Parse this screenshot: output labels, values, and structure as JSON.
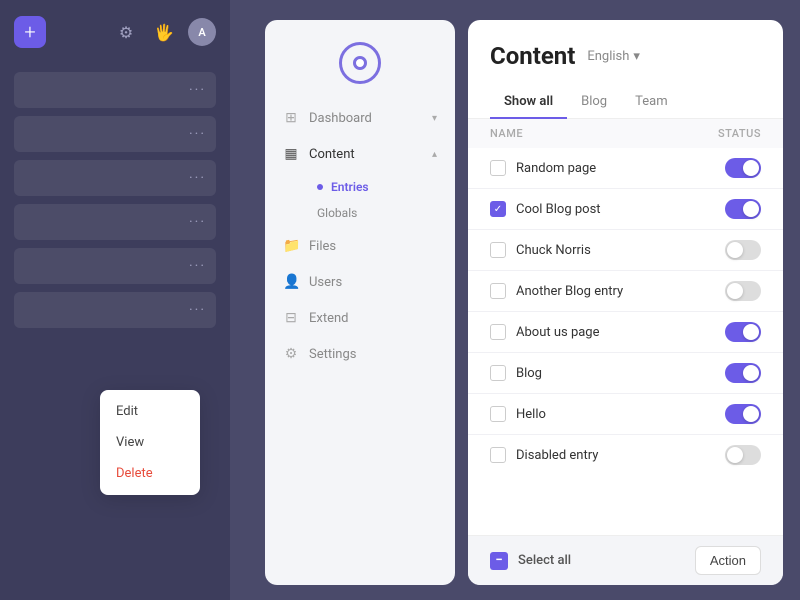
{
  "leftPanel": {
    "addBtn": "+",
    "avatarLabel": "A",
    "cards": [
      {
        "dots": "···"
      },
      {
        "dots": "···"
      },
      {
        "dots": "···"
      },
      {
        "dots": "···"
      },
      {
        "dots": "···"
      },
      {
        "dots": "···"
      }
    ],
    "contextMenu": {
      "edit": "Edit",
      "view": "View",
      "delete": "Delete"
    }
  },
  "sidebar": {
    "navItems": [
      {
        "label": "Dashboard",
        "icon": "⊞",
        "hasChevron": true
      },
      {
        "label": "Content",
        "icon": "📄",
        "hasChevron": true,
        "active": true
      },
      {
        "label": "Files",
        "icon": "📁",
        "hasChevron": false
      },
      {
        "label": "Users",
        "icon": "👤",
        "hasChevron": false
      },
      {
        "label": "Extend",
        "icon": "⊟",
        "hasChevron": false
      },
      {
        "label": "Settings",
        "icon": "⚙",
        "hasChevron": false
      }
    ],
    "subNav": {
      "entries": "Entries",
      "globals": "Globals"
    }
  },
  "main": {
    "title": "Content",
    "language": "English",
    "tabs": [
      {
        "label": "Show all",
        "active": true
      },
      {
        "label": "Blog",
        "active": false
      },
      {
        "label": "Team",
        "active": false
      }
    ],
    "tableHeader": {
      "name": "Name",
      "status": "Status"
    },
    "entries": [
      {
        "name": "Random page",
        "checked": false,
        "toggleOn": true
      },
      {
        "name": "Cool Blog post",
        "checked": true,
        "toggleOn": true
      },
      {
        "name": "Chuck Norris",
        "checked": false,
        "toggleOn": false
      },
      {
        "name": "Another Blog entry",
        "checked": false,
        "toggleOn": false
      },
      {
        "name": "About us page",
        "checked": false,
        "toggleOn": true
      },
      {
        "name": "Blog",
        "checked": false,
        "toggleOn": true
      },
      {
        "name": "Hello",
        "checked": false,
        "toggleOn": true
      },
      {
        "name": "Disabled entry",
        "checked": false,
        "toggleOn": false
      }
    ],
    "bottomBar": {
      "selectAllLabel": "Select all",
      "actionLabel": "Action"
    }
  }
}
